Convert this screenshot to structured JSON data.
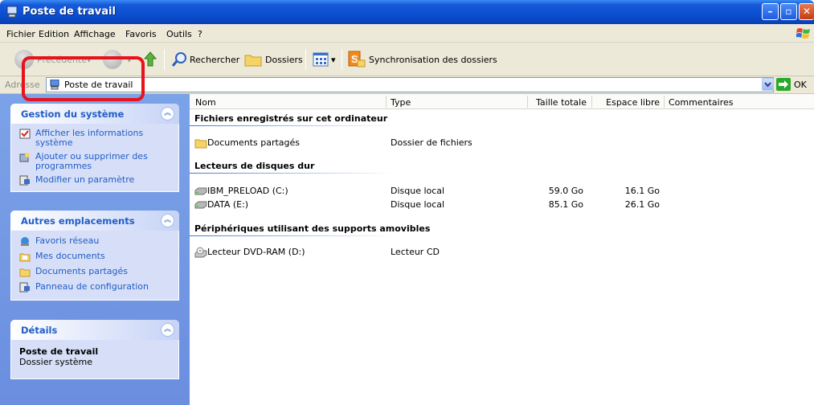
{
  "window": {
    "title": "Poste de travail"
  },
  "menu": [
    "Fichier",
    "Edition",
    "Affichage",
    "Favoris",
    "Outils",
    "?"
  ],
  "toolbar": {
    "back_label": "Précédente",
    "search_label": "Rechercher",
    "folders_label": "Dossiers",
    "sync_label": "Synchronisation des dossiers"
  },
  "address": {
    "label": "Adresse",
    "value": "Poste de travail",
    "go_label": "OK"
  },
  "taskpane": {
    "system": {
      "title": "Gestion du système",
      "items": [
        "Afficher les informations système",
        "Ajouter ou supprimer des programmes",
        "Modifier un paramètre"
      ]
    },
    "places": {
      "title": "Autres emplacements",
      "items": [
        "Favoris réseau",
        "Mes documents",
        "Documents partagés",
        "Panneau de configuration"
      ]
    },
    "details": {
      "title": "Détails",
      "name": "Poste de travail",
      "type": "Dossier système"
    }
  },
  "columns": [
    "Nom",
    "Type",
    "Taille totale",
    "Espace libre",
    "Commentaires"
  ],
  "groups": [
    {
      "title": "Fichiers enregistrés sur cet ordinateur",
      "items": [
        {
          "name": "Documents partagés",
          "type": "Dossier de fichiers",
          "size": "",
          "free": "",
          "icon": "folder-icon"
        }
      ]
    },
    {
      "title": "Lecteurs de disques dur",
      "items": [
        {
          "name": "IBM_PRELOAD (C:)",
          "type": "Disque local",
          "size": "59.0 Go",
          "free": "16.1 Go",
          "icon": "hard-drive-icon"
        },
        {
          "name": "DATA (E:)",
          "type": "Disque local",
          "size": "85.1 Go",
          "free": "26.1 Go",
          "icon": "hard-drive-icon"
        }
      ]
    },
    {
      "title": "Périphériques utilisant des supports amovibles",
      "items": [
        {
          "name": "Lecteur DVD-RAM (D:)",
          "type": "Lecteur CD",
          "size": "",
          "free": "",
          "icon": "dvd-drive-icon"
        }
      ]
    }
  ],
  "colors": {
    "titlebar": "#0b4fd0",
    "taskpane": "#7ba3e8",
    "link": "#215dc6",
    "highlight": "#e8121b"
  }
}
